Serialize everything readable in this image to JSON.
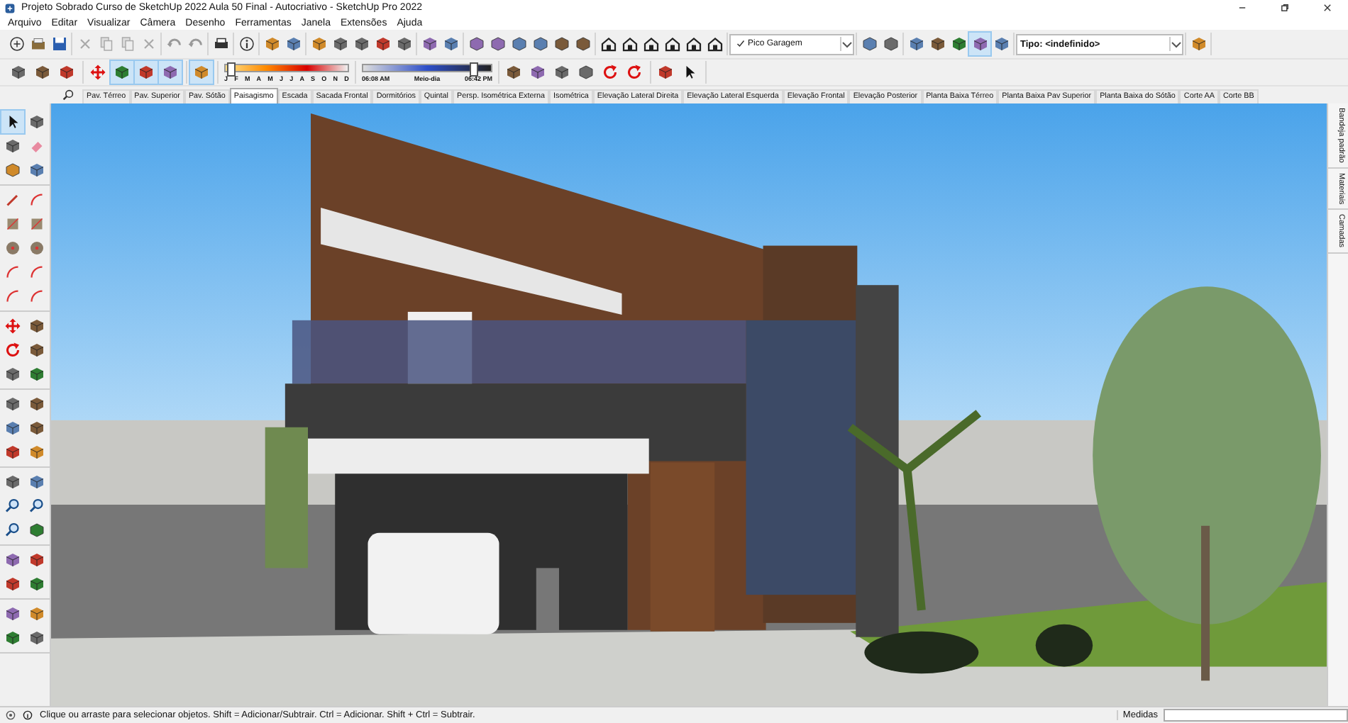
{
  "window": {
    "title": "Projeto Sobrado Curso de SketchUp 2022 Aula 50 Final - Autocriativo - SketchUp Pro 2022"
  },
  "menu": [
    "Arquivo",
    "Editar",
    "Visualizar",
    "Câmera",
    "Desenho",
    "Ferramentas",
    "Janela",
    "Extensões",
    "Ajuda"
  ],
  "toolbar_1": [
    {
      "kind": "tools",
      "items": [
        {
          "selected": false
        },
        {
          "selected": false
        },
        {
          "selected": false
        }
      ]
    },
    {
      "kind": "tools",
      "items": [
        {
          "selected": false
        },
        {
          "selected": false
        },
        {
          "selected": false
        },
        {
          "selected": false
        }
      ]
    },
    {
      "kind": "tools",
      "items": [
        {
          "selected": false
        },
        {
          "selected": false
        }
      ]
    },
    {
      "kind": "tools",
      "items": [
        {
          "selected": false
        }
      ]
    },
    {
      "kind": "tools",
      "items": [
        {
          "selected": false
        }
      ]
    },
    {
      "kind": "tools",
      "items": [
        {
          "selected": false
        },
        {
          "selected": false
        }
      ]
    },
    {
      "kind": "tools",
      "items": [
        {
          "selected": false
        },
        {
          "selected": false
        },
        {
          "selected": false
        },
        {
          "selected": false
        },
        {
          "selected": false
        }
      ]
    },
    {
      "kind": "tools",
      "items": [
        {
          "selected": false
        },
        {
          "selected": false
        }
      ]
    },
    {
      "kind": "tools",
      "items": [
        {
          "selected": false
        },
        {
          "selected": false
        },
        {
          "selected": false
        },
        {
          "selected": false
        },
        {
          "selected": false
        },
        {
          "selected": false
        }
      ]
    },
    {
      "kind": "tools",
      "items": [
        {
          "selected": false
        },
        {
          "selected": false
        },
        {
          "selected": false
        },
        {
          "selected": false
        },
        {
          "selected": false
        },
        {
          "selected": false
        }
      ]
    },
    {
      "kind": "scene_select",
      "value": "Pico Garagem"
    },
    {
      "kind": "tools",
      "items": [
        {
          "selected": false
        },
        {
          "selected": false
        }
      ]
    },
    {
      "kind": "tools",
      "items": [
        {
          "selected": false
        },
        {
          "selected": false
        },
        {
          "selected": false
        },
        {
          "selected": true
        },
        {
          "selected": false
        }
      ]
    },
    {
      "kind": "type_select",
      "value": "Tipo: <indefinido>"
    },
    {
      "kind": "tools",
      "items": [
        {
          "selected": false
        }
      ]
    }
  ],
  "toolbar_2": [
    {
      "kind": "tools",
      "items": [
        {
          "selected": false
        },
        {
          "selected": false
        },
        {
          "selected": false
        }
      ]
    },
    {
      "kind": "tools",
      "items": [
        {
          "selected": false
        },
        {
          "selected": true
        },
        {
          "selected": true
        },
        {
          "selected": true
        }
      ]
    },
    {
      "kind": "tools",
      "items": [
        {
          "selected": true
        }
      ]
    },
    {
      "kind": "month_slider",
      "labels": [
        "J",
        "F",
        "M",
        "A",
        "M",
        "J",
        "J",
        "A",
        "S",
        "O",
        "N",
        "D"
      ],
      "level": 0.04
    },
    {
      "kind": "time_slider",
      "labels": [
        "06:08 AM",
        "Meio-dia",
        "06:42 PM"
      ],
      "level": 0.86
    },
    {
      "kind": "tools",
      "items": [
        {
          "selected": false
        },
        {
          "selected": false
        },
        {
          "selected": false
        },
        {
          "selected": false
        },
        {
          "selected": false
        },
        {
          "selected": false
        }
      ]
    },
    {
      "kind": "tools",
      "items": [
        {
          "selected": false
        },
        {
          "selected": false
        }
      ]
    }
  ],
  "scene_tabs": [
    {
      "label": "Pav. Térreo",
      "selected": false
    },
    {
      "label": "Pav. Superior",
      "selected": false
    },
    {
      "label": "Pav. Sótão",
      "selected": false
    },
    {
      "label": "Paisagismo",
      "selected": true
    },
    {
      "label": "Escada",
      "selected": false
    },
    {
      "label": "Sacada Frontal",
      "selected": false
    },
    {
      "label": "Dormitórios",
      "selected": false
    },
    {
      "label": "Quintal",
      "selected": false
    },
    {
      "label": "Persp. Isométrica Externa",
      "selected": false
    },
    {
      "label": "Isométrica",
      "selected": false
    },
    {
      "label": "Elevação Lateral Direita",
      "selected": false
    },
    {
      "label": "Elevação Lateral Esquerda",
      "selected": false
    },
    {
      "label": "Elevação Frontal",
      "selected": false
    },
    {
      "label": "Elevação Posterior",
      "selected": false
    },
    {
      "label": "Planta Baixa Térreo",
      "selected": false
    },
    {
      "label": "Planta Baixa Pav Superior",
      "selected": false
    },
    {
      "label": "Planta Baixa do Sótão",
      "selected": false
    },
    {
      "label": "Corte AA",
      "selected": false
    },
    {
      "label": "Corte BB",
      "selected": false
    }
  ],
  "left_toolbar": [
    {
      "kind": "tools",
      "items": [
        {
          "selected": true
        },
        {
          "selected": false
        },
        {
          "selected": false
        },
        {
          "selected": false
        },
        {
          "selected": false
        },
        {
          "selected": false
        }
      ]
    },
    {
      "kind": "tools",
      "items": [
        {
          "selected": false
        },
        {
          "selected": false
        },
        {
          "selected": false
        },
        {
          "selected": false
        },
        {
          "selected": false
        },
        {
          "selected": false
        },
        {
          "selected": false
        },
        {
          "selected": false
        },
        {
          "selected": false
        },
        {
          "selected": false
        }
      ]
    },
    {
      "kind": "tools",
      "items": [
        {
          "selected": false
        },
        {
          "selected": false
        },
        {
          "selected": false
        },
        {
          "selected": false
        },
        {
          "selected": false
        },
        {
          "selected": false
        }
      ]
    },
    {
      "kind": "tools",
      "items": [
        {
          "selected": false
        },
        {
          "selected": false
        },
        {
          "selected": false
        },
        {
          "selected": false
        },
        {
          "selected": false
        },
        {
          "selected": false
        }
      ]
    },
    {
      "kind": "tools",
      "items": [
        {
          "selected": false
        },
        {
          "selected": false
        },
        {
          "selected": false
        },
        {
          "selected": false
        },
        {
          "selected": false
        },
        {
          "selected": false
        }
      ]
    },
    {
      "kind": "tools",
      "items": [
        {
          "selected": false
        },
        {
          "selected": false
        },
        {
          "selected": false
        },
        {
          "selected": false
        }
      ]
    },
    {
      "kind": "tools",
      "items": [
        {
          "selected": false
        },
        {
          "selected": false
        },
        {
          "selected": false
        },
        {
          "selected": false
        }
      ]
    }
  ],
  "tray_tabs": [
    "Bandeja padrão",
    "Materiais",
    "Camadas"
  ],
  "status_bar": {
    "message": "Clique ou arraste para selecionar objetos. Shift = Adicionar/Subtrair. Ctrl = Adicionar. Shift + Ctrl = Subtrair.",
    "measurements_label": "Medidas"
  }
}
